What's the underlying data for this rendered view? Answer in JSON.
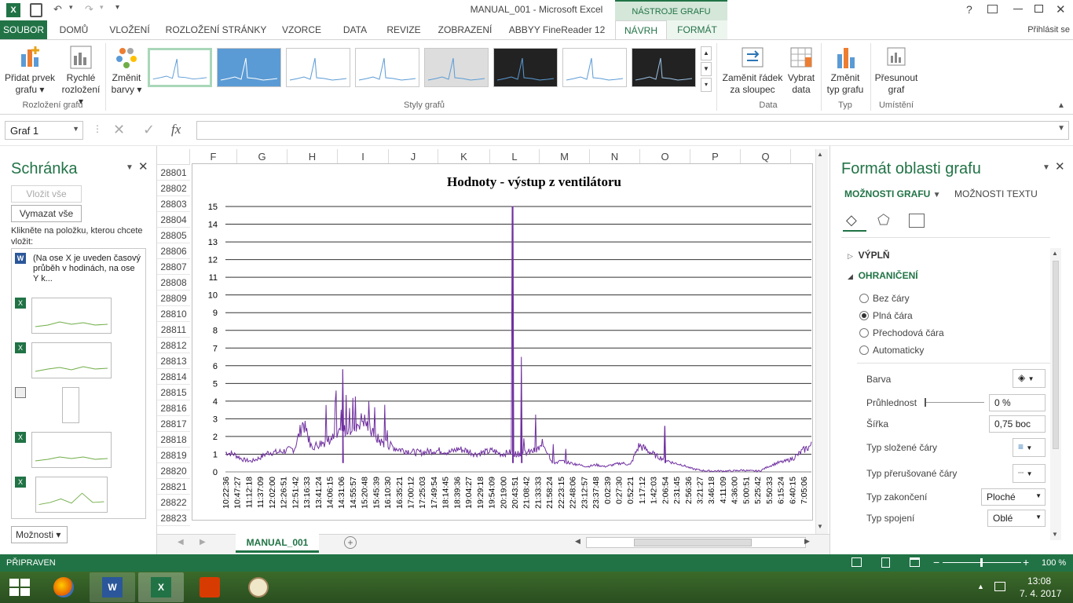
{
  "window": {
    "title": "MANUAL_001 - Microsoft Excel",
    "help": "?",
    "signin": "Přihlásit se"
  },
  "ribbon_tabs": {
    "file": "SOUBOR",
    "home": "DOMŮ",
    "insert": "VLOŽENÍ",
    "page_layout": "ROZLOŽENÍ STRÁNKY",
    "formulas": "VZORCE",
    "data": "DATA",
    "review": "REVIZE",
    "view": "ZOBRAZENÍ",
    "abbyy": "ABBYY FineReader 12",
    "contextual_header": "NÁSTROJE GRAFU",
    "design": "NÁVRH",
    "format": "FORMÁT"
  },
  "ribbon": {
    "add_element_1": "Přidat prvek",
    "add_element_2": "grafu",
    "quick_layout_1": "Rychlé",
    "quick_layout_2": "rozložení",
    "change_colors_1": "Změnit",
    "change_colors_2": "barvy",
    "group_layouts": "Rozložení grafu",
    "group_styles": "Styly grafů",
    "switch_1": "Zaměnit řádek",
    "switch_2": "za sloupec",
    "select_data_1": "Vybrat",
    "select_data_2": "data",
    "group_data": "Data",
    "change_type_1": "Změnit",
    "change_type_2": "typ grafu",
    "group_type": "Typ",
    "move_1": "Přesunout",
    "move_2": "graf",
    "group_location": "Umístění"
  },
  "formula_bar": {
    "namebox": "Graf 1",
    "fx": "fx"
  },
  "clipboard": {
    "title": "Schránka",
    "paste_all": "Vložit vše",
    "clear_all": "Vymazat vše",
    "hint": "Klikněte na položku, kterou chcete vložit:",
    "first_item": "(Na ose X je uveden časový průběh v hodinách, na ose Y k...",
    "options": "Možnosti"
  },
  "grid": {
    "columns": [
      "F",
      "G",
      "H",
      "I",
      "J",
      "K",
      "L",
      "M",
      "N",
      "O",
      "P",
      "Q"
    ],
    "rows": [
      "28801",
      "28802",
      "28803",
      "28804",
      "28805",
      "28806",
      "28807",
      "28808",
      "28809",
      "28810",
      "28811",
      "28812",
      "28813",
      "28814",
      "28815",
      "28816",
      "28817",
      "28818",
      "28819",
      "28820",
      "28821",
      "28822",
      "28823"
    ],
    "sheet_tab": "MANUAL_001"
  },
  "chart_data": {
    "type": "line",
    "title": "Hodnoty - výstup z ventilátoru",
    "ylim": [
      0,
      15
    ],
    "y_ticks": [
      "0",
      "1",
      "2",
      "3",
      "4",
      "5",
      "6",
      "7",
      "8",
      "9",
      "10",
      "11",
      "12",
      "13",
      "14",
      "15"
    ],
    "x_ticks": [
      "10:22:36",
      "10:47:27",
      "11:12:18",
      "11:37:09",
      "12:02:00",
      "12:26:51",
      "12:51:42",
      "13:16:33",
      "13:41:24",
      "14:06:15",
      "14:31:06",
      "14:55:57",
      "15:20:48",
      "15:45:39",
      "16:10:30",
      "16:35:21",
      "17:00:12",
      "17:25:03",
      "17:49:54",
      "18:14:45",
      "18:39:36",
      "19:04:27",
      "19:29:18",
      "19:54:09",
      "20:19:00",
      "20:43:51",
      "21:08:42",
      "21:33:33",
      "21:58:24",
      "22:23:15",
      "22:48:06",
      "23:12:57",
      "23:37:48",
      "0:02:39",
      "0:27:30",
      "0:52:21",
      "1:17:12",
      "1:42:03",
      "2:06:54",
      "2:31:45",
      "2:56:36",
      "3:21:27",
      "3:46:18",
      "4:11:09",
      "4:36:00",
      "5:00:51",
      "5:25:42",
      "5:50:33",
      "6:15:24",
      "6:40:15",
      "7:05:06"
    ],
    "series": [
      {
        "color": "#7030a0",
        "values": [
          1.1,
          1.0,
          0.7,
          0.6,
          0.8,
          1.1,
          1.1,
          1.2,
          1.3,
          2.8,
          1.4,
          1.6,
          1.8,
          2.0,
          2.4,
          2.6,
          3.0,
          2.2,
          1.7,
          1.5,
          1.3,
          1.2,
          1.1,
          1.1,
          1.2,
          1.2,
          1.1,
          1.3,
          1.2,
          1.0,
          1.1,
          1.2,
          1.0,
          1.1,
          1.0,
          1.1,
          1.2,
          1.5,
          0.5,
          0.6,
          0.5,
          0.4,
          0.3,
          0.4,
          0.3,
          0.4,
          0.5,
          0.4,
          1.5,
          1.2,
          0.9,
          0.7,
          0.5,
          0.4,
          0.2,
          0.1,
          0.05,
          0.05,
          0.05,
          0.05,
          0.1,
          0.05,
          0.05,
          0.3,
          0.5,
          0.6,
          0.8,
          1.2,
          1.5
        ],
        "peaks": [
          [
            0.49,
            15.0
          ],
          [
            0.505,
            6.5
          ],
          [
            0.2,
            5.8
          ],
          [
            0.75,
            2.6
          ]
        ]
      }
    ],
    "grid": true,
    "legend": "none"
  },
  "format_pane": {
    "title": "Formát oblasti grafu",
    "tab_chart": "MOŽNOSTI GRAFU",
    "tab_text": "MOŽNOSTI TEXTU",
    "fill": "VÝPLŇ",
    "border": "OHRANIČENÍ",
    "no_line": "Bez čáry",
    "solid_line": "Plná čára",
    "gradient_line": "Přechodová čára",
    "automatic": "Automaticky",
    "color": "Barva",
    "transparency": "Průhlednost",
    "transparency_value": "0 %",
    "width": "Šířka",
    "width_value": "0,75 boc",
    "compound_type": "Typ složené čáry",
    "dash_type": "Typ přerušované čáry",
    "cap_type": "Typ zakončení",
    "cap_value": "Ploché",
    "join_type": "Typ spojení",
    "join_value": "Oblé"
  },
  "status": {
    "ready": "PŘIPRAVEN",
    "zoom": "100 %"
  },
  "taskbar": {
    "time": "13:08",
    "date": "7. 4. 2017"
  }
}
